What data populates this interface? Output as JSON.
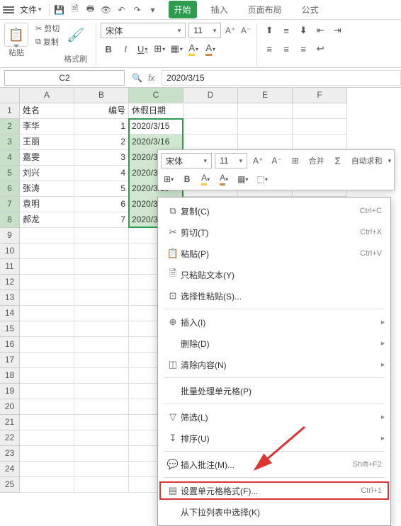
{
  "menubar": {
    "file": "文件",
    "tabs": {
      "start": "开始",
      "insert": "插入",
      "layout": "页面布局",
      "formula": "公式"
    }
  },
  "ribbon": {
    "paste": "粘贴",
    "cut": "剪切",
    "copy": "复制",
    "format_painter": "格式刷",
    "font_name": "宋体",
    "font_size": "11",
    "bold": "B",
    "italic": "I",
    "underline": "U",
    "fill": "A",
    "fontcolor": "A"
  },
  "namebox": "C2",
  "formula": "2020/3/15",
  "columns": [
    "A",
    "B",
    "C",
    "D",
    "E",
    "F"
  ],
  "rows": [
    {
      "n": 1,
      "cells": [
        "姓名",
        "编号",
        "休假日期",
        "",
        "",
        ""
      ]
    },
    {
      "n": 2,
      "cells": [
        "李华",
        "1",
        "2020/3/15",
        "",
        "",
        ""
      ]
    },
    {
      "n": 3,
      "cells": [
        "王丽",
        "2",
        "2020/3/16",
        "",
        "",
        ""
      ]
    },
    {
      "n": 4,
      "cells": [
        "嘉雯",
        "3",
        "2020/3/17",
        "",
        "",
        ""
      ]
    },
    {
      "n": 5,
      "cells": [
        "刘兴",
        "4",
        "2020/3/18",
        "",
        "",
        ""
      ]
    },
    {
      "n": 6,
      "cells": [
        "张涛",
        "5",
        "2020/3/19",
        "",
        "",
        ""
      ]
    },
    {
      "n": 7,
      "cells": [
        "袁明",
        "6",
        "2020/3/20",
        "",
        "",
        ""
      ]
    },
    {
      "n": 8,
      "cells": [
        "郝龙",
        "7",
        "2020/3/21",
        "",
        "",
        ""
      ]
    },
    {
      "n": 9,
      "cells": [
        "",
        "",
        "",
        "",
        "",
        ""
      ]
    },
    {
      "n": 10,
      "cells": [
        "",
        "",
        "",
        "",
        "",
        ""
      ]
    },
    {
      "n": 11,
      "cells": [
        "",
        "",
        "",
        "",
        "",
        ""
      ]
    },
    {
      "n": 12,
      "cells": [
        "",
        "",
        "",
        "",
        "",
        ""
      ]
    },
    {
      "n": 13,
      "cells": [
        "",
        "",
        "",
        "",
        "",
        ""
      ]
    },
    {
      "n": 14,
      "cells": [
        "",
        "",
        "",
        "",
        "",
        ""
      ]
    },
    {
      "n": 15,
      "cells": [
        "",
        "",
        "",
        "",
        "",
        ""
      ]
    },
    {
      "n": 16,
      "cells": [
        "",
        "",
        "",
        "",
        "",
        ""
      ]
    },
    {
      "n": 17,
      "cells": [
        "",
        "",
        "",
        "",
        "",
        ""
      ]
    },
    {
      "n": 18,
      "cells": [
        "",
        "",
        "",
        "",
        "",
        ""
      ]
    },
    {
      "n": 19,
      "cells": [
        "",
        "",
        "",
        "",
        "",
        ""
      ]
    },
    {
      "n": 20,
      "cells": [
        "",
        "",
        "",
        "",
        "",
        ""
      ]
    },
    {
      "n": 21,
      "cells": [
        "",
        "",
        "",
        "",
        "",
        ""
      ]
    },
    {
      "n": 22,
      "cells": [
        "",
        "",
        "",
        "",
        "",
        ""
      ]
    },
    {
      "n": 23,
      "cells": [
        "",
        "",
        "",
        "",
        "",
        ""
      ]
    },
    {
      "n": 24,
      "cells": [
        "",
        "",
        "",
        "",
        "",
        ""
      ]
    },
    {
      "n": 25,
      "cells": [
        "",
        "",
        "",
        "",
        "",
        ""
      ]
    }
  ],
  "minitool": {
    "font_name": "宋体",
    "font_size": "11",
    "merge": "合并",
    "autosum": "自动求和"
  },
  "context": {
    "copy": "复制(C)",
    "copy_sc": "Ctrl+C",
    "cut": "剪切(T)",
    "cut_sc": "Ctrl+X",
    "paste": "粘贴(P)",
    "paste_sc": "Ctrl+V",
    "paste_text": "只粘贴文本(Y)",
    "paste_special": "选择性粘贴(S)...",
    "insert": "插入(I)",
    "delete": "删除(D)",
    "clear": "清除内容(N)",
    "batch": "批量处理单元格(P)",
    "filter": "筛选(L)",
    "sort": "排序(U)",
    "comment": "插入批注(M)...",
    "comment_sc": "Shift+F2",
    "format_cells": "设置单元格格式(F)...",
    "format_cells_sc": "Ctrl+1",
    "dropdown": "从下拉列表中选择(K)"
  }
}
